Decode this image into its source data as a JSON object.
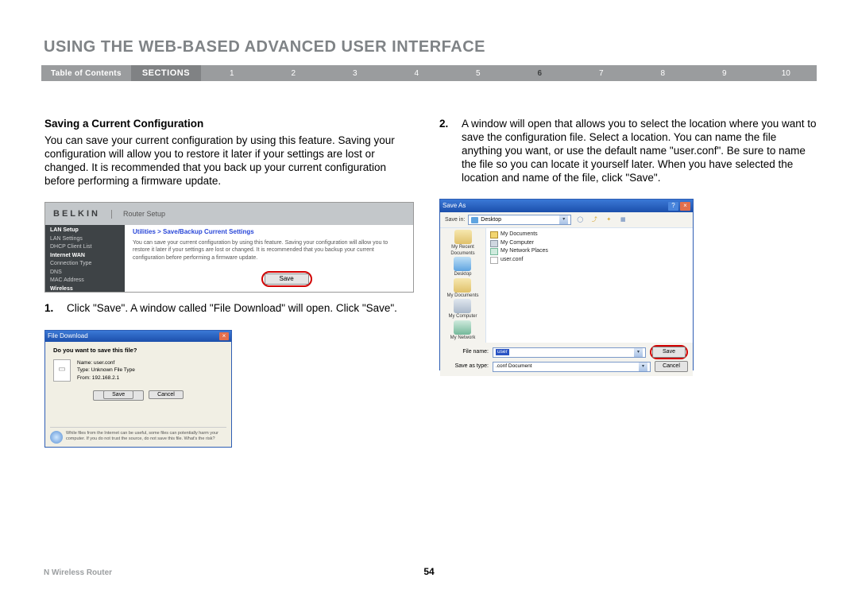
{
  "pageTitle": "USING THE WEB-BASED ADVANCED USER INTERFACE",
  "nav": {
    "toc": "Table of Contents",
    "sections": "SECTIONS",
    "items": [
      "1",
      "2",
      "3",
      "4",
      "5",
      "6",
      "7",
      "8",
      "9",
      "10"
    ],
    "current": "6"
  },
  "left": {
    "subhead": "Saving a Current Configuration",
    "para": "You can save your current configuration by using this feature. Saving your configuration will allow you to restore it later if your settings are lost or changed. It is recommended that you back up your current configuration before performing a firmware update.",
    "step1_num": "1.",
    "step1_text": "Click \"Save\". A window called \"File Download\" will open. Click \"Save\"."
  },
  "right": {
    "step2_num": "2.",
    "step2_text": "A window will open that allows you to select the location where you want to save the configuration file. Select a location. You can name the file anything you want, or use the default name \"user.conf\". Be sure to name the file so you can locate it yourself later. When you have selected the location and name of the file, click \"Save\"."
  },
  "router": {
    "brand": "BELKIN",
    "subtitle": "Router Setup",
    "side": {
      "lan": "LAN Setup",
      "lanSettings": "LAN Settings",
      "dhcp": "DHCP Client List",
      "wan": "Internet WAN",
      "conn": "Connection Type",
      "dns": "DNS",
      "mac": "MAC Address",
      "wireless": "Wireless"
    },
    "breadcrumb": "Utilities > Save/Backup Current Settings",
    "desc": "You can save your current configuration by using this feature. Saving your configuration will allow you to restore it later if your settings are lost or changed. It is recommended that you backup your current configuration before performing a firmware update.",
    "saveBtn": "Save"
  },
  "fileDownload": {
    "title": "File Download",
    "question": "Do you want to save this file?",
    "name": "Name:  user.conf",
    "type": "Type:  Unknown File Type",
    "from": "From:  192.168.2.1",
    "save": "Save",
    "cancel": "Cancel",
    "warn": "While files from the Internet can be useful, some files can potentially harm your computer. If you do not trust the source, do not save this file. What's the risk?"
  },
  "saveAs": {
    "title": "Save As",
    "saveInLabel": "Save in:",
    "saveInValue": "Desktop",
    "places": [
      "My Recent Documents",
      "Desktop",
      "My Documents",
      "My Computer",
      "My Network"
    ],
    "list": [
      "My Documents",
      "My Computer",
      "My Network Places",
      "user.conf"
    ],
    "fileNameLabel": "File name:",
    "fileNameValue": "user",
    "saveTypeLabel": "Save as type:",
    "saveTypeValue": ".conf Document",
    "save": "Save",
    "cancel": "Cancel"
  },
  "footer": {
    "product": "N Wireless Router",
    "page": "54"
  }
}
